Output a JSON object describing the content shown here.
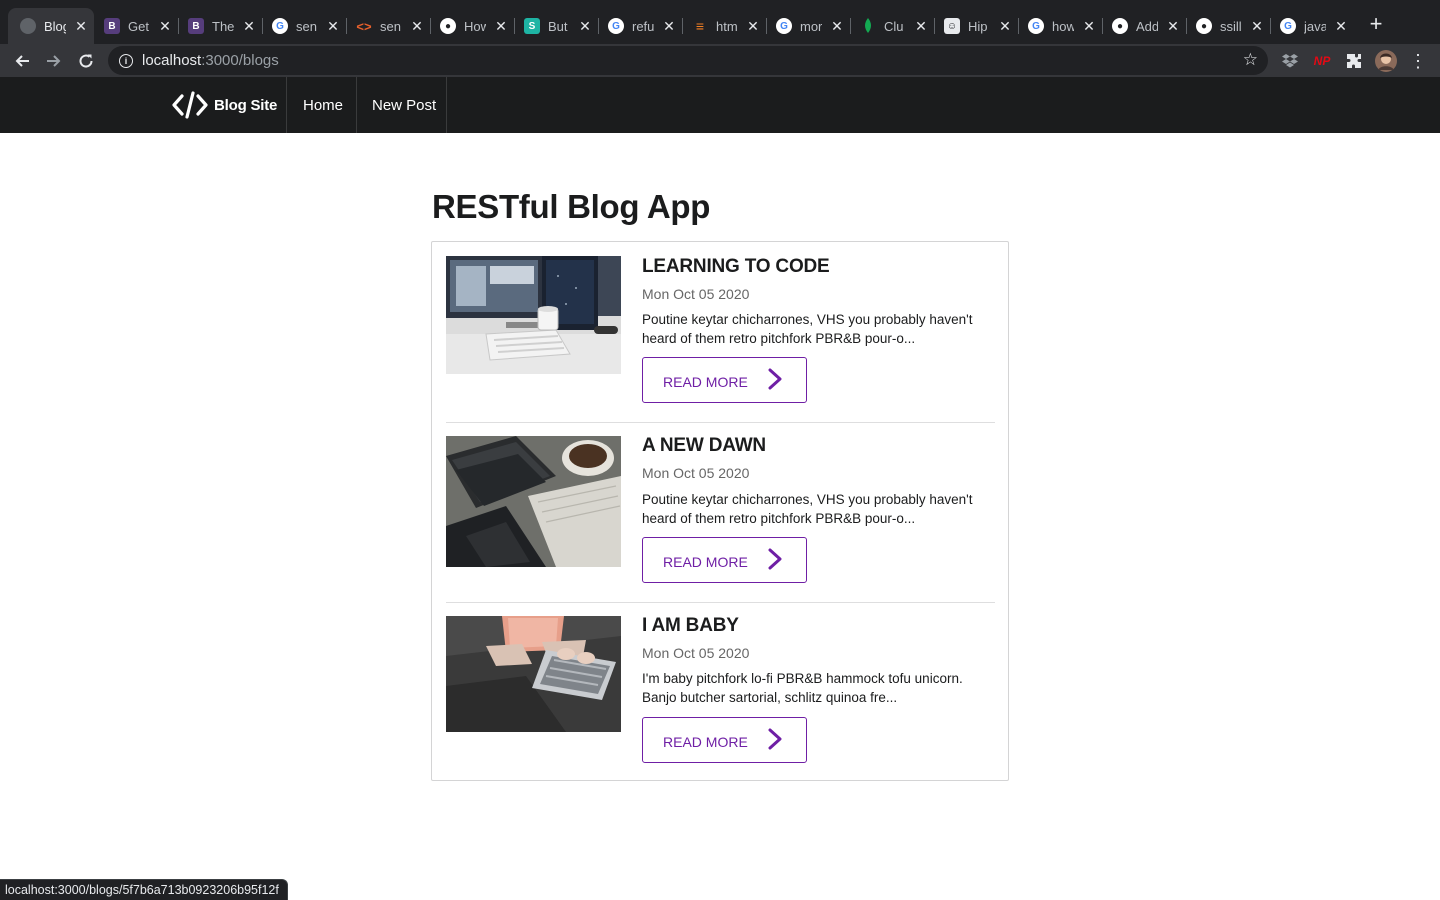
{
  "browser": {
    "tabs": [
      {
        "title": "Blog",
        "icon": "globe-icon",
        "active": true
      },
      {
        "title": "Get",
        "icon": "bootstrap-icon"
      },
      {
        "title": "The",
        "icon": "bootstrap-icon"
      },
      {
        "title": "sen",
        "icon": "google-icon"
      },
      {
        "title": "sen",
        "icon": "code-brackets-icon"
      },
      {
        "title": "How",
        "icon": "github-icon"
      },
      {
        "title": "But",
        "icon": "s-icon"
      },
      {
        "title": "refu",
        "icon": "google-icon"
      },
      {
        "title": "htm",
        "icon": "stackoverflow-icon"
      },
      {
        "title": "mor",
        "icon": "google-icon"
      },
      {
        "title": "Clu",
        "icon": "mongodb-leaf-icon"
      },
      {
        "title": "Hip",
        "icon": "hipster-icon"
      },
      {
        "title": "how",
        "icon": "google-icon"
      },
      {
        "title": "Add",
        "icon": "github-icon"
      },
      {
        "title": "ssill",
        "icon": "github-icon"
      },
      {
        "title": "java",
        "icon": "google-icon"
      }
    ],
    "address": {
      "host": "localhost",
      "path": ":3000/blogs"
    },
    "status_url": "localhost:3000/blogs/5f7b6a713b0923206b95f12f",
    "extension_badge": "NP"
  },
  "site": {
    "brand": "Blog Site",
    "nav": {
      "home": "Home",
      "new_post": "New Post"
    }
  },
  "main": {
    "title": "RESTful Blog App",
    "posts": [
      {
        "title": "LEARNING TO CODE",
        "date": "Mon Oct 05 2020",
        "excerpt": "Poutine keytar chicharrones, VHS you probably haven't heard of them retro pitchfork PBR&B pour-o...",
        "read_more": "READ MORE",
        "image": "desk-with-monitor-keyboard-and-mug"
      },
      {
        "title": "A NEW DAWN",
        "date": "Mon Oct 05 2020",
        "excerpt": "Poutine keytar chicharrones, VHS you probably haven't heard of them retro pitchfork PBR&B pour-o...",
        "read_more": "READ MORE",
        "image": "notebooks-and-coffee-cup"
      },
      {
        "title": "I AM BABY",
        "date": "Mon Oct 05 2020",
        "excerpt": "I'm baby pitchfork lo-fi PBR&B hammock tofu unicorn. Banjo butcher sartorial, schlitz quinoa fre...",
        "read_more": "READ MORE",
        "image": "person-typing-on-laptop"
      }
    ]
  },
  "colors": {
    "accent": "#6f1fa5",
    "navbar": "#1b1c1d",
    "chrome_dark": "#202124",
    "chrome_toolbar": "#35363a"
  }
}
